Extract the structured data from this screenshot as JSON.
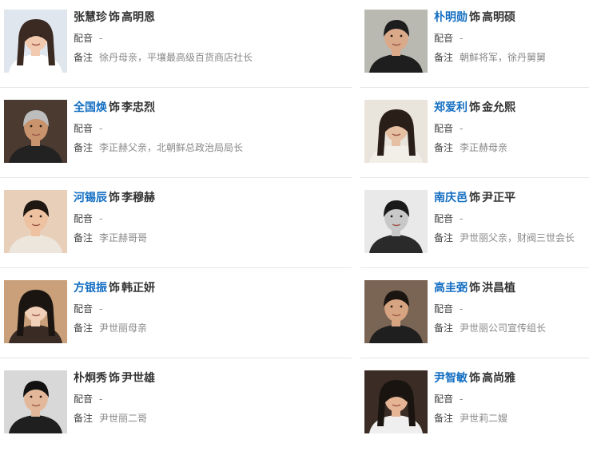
{
  "cast": [
    {
      "actor": "张慧珍",
      "linked": false,
      "as": "饰",
      "role": "高明恩",
      "dub_label": "配音",
      "dub": "-",
      "note_label": "备注",
      "note": "徐丹母亲，平壤最高级百货商店社长",
      "photo_icon": "portrait-woman"
    },
    {
      "actor": "朴明勋",
      "linked": true,
      "as": "饰",
      "role": "高明硕",
      "dub_label": "配音",
      "dub": "-",
      "note_label": "备注",
      "note": "朝鲜将军，徐丹舅舅",
      "photo_icon": "portrait-man"
    },
    {
      "actor": "全国焕",
      "linked": true,
      "as": "饰",
      "role": "李忠烈",
      "dub_label": "配音",
      "dub": "-",
      "note_label": "备注",
      "note": "李正赫父亲，北朝鲜总政治局局长",
      "photo_icon": "portrait-man"
    },
    {
      "actor": "郑爱利",
      "linked": true,
      "as": "饰",
      "role": "金允熙",
      "dub_label": "配音",
      "dub": "-",
      "note_label": "备注",
      "note": "李正赫母亲",
      "photo_icon": "portrait-woman"
    },
    {
      "actor": "河锡辰",
      "linked": true,
      "as": "饰",
      "role": "李穆赫",
      "dub_label": "配音",
      "dub": "-",
      "note_label": "备注",
      "note": "李正赫哥哥",
      "photo_icon": "portrait-man"
    },
    {
      "actor": "南庆邑",
      "linked": true,
      "as": "饰",
      "role": "尹正平",
      "dub_label": "配音",
      "dub": "-",
      "note_label": "备注",
      "note": "尹世丽父亲，财阀三世会长",
      "photo_icon": "portrait-man"
    },
    {
      "actor": "方银振",
      "linked": true,
      "as": "饰",
      "role": "韩正妍",
      "dub_label": "配音",
      "dub": "-",
      "note_label": "备注",
      "note": "尹世丽母亲",
      "photo_icon": "portrait-woman"
    },
    {
      "actor": "高圭弼",
      "linked": true,
      "as": "饰",
      "role": "洪昌植",
      "dub_label": "配音",
      "dub": "-",
      "note_label": "备注",
      "note": "尹世丽公司宣传组长",
      "photo_icon": "portrait-man"
    },
    {
      "actor": "朴炯秀",
      "linked": false,
      "as": "饰",
      "role": "尹世雄",
      "dub_label": "配音",
      "dub": "-",
      "note_label": "备注",
      "note": "尹世丽二哥",
      "photo_icon": "portrait-man"
    },
    {
      "actor": "尹智敏",
      "linked": true,
      "as": "饰",
      "role": "高尚雅",
      "dub_label": "配音",
      "dub": "-",
      "note_label": "备注",
      "note": "尹世莉二嫂",
      "photo_icon": "portrait-woman"
    }
  ],
  "colors": {
    "link": "#136ec2",
    "text": "#333333",
    "muted": "#888888",
    "separator": "#e6e6e6"
  }
}
